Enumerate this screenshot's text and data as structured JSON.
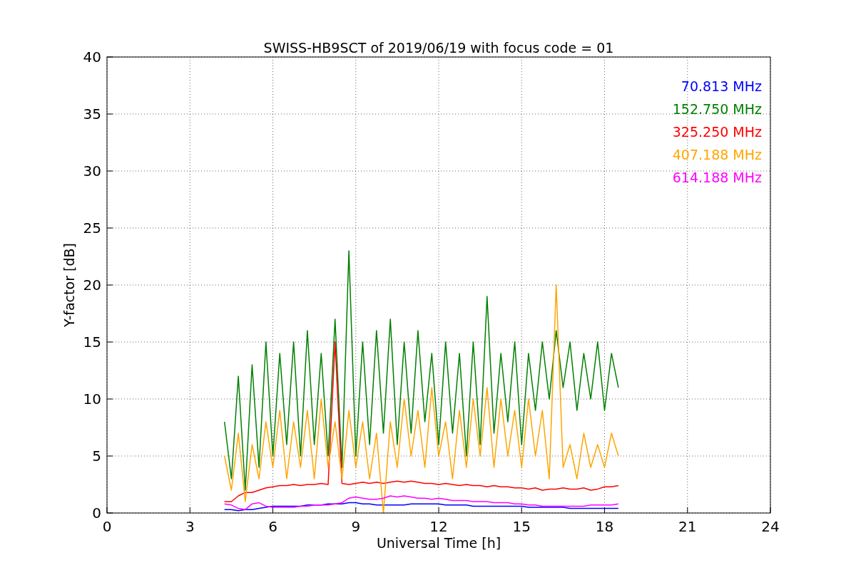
{
  "chart_data": {
    "type": "line",
    "title": "SWISS-HB9SCT of 2019/06/19 with focus code = 01",
    "xlabel": "Universal Time [h]",
    "ylabel": "Y-factor [dB]",
    "grid": true,
    "xlim": [
      0,
      24
    ],
    "ylim": [
      0,
      40
    ],
    "xticks": [
      0,
      3,
      6,
      9,
      12,
      15,
      18,
      21,
      24
    ],
    "yticks": [
      0,
      5,
      10,
      15,
      20,
      25,
      30,
      35,
      40
    ],
    "x": [
      4.25,
      4.5,
      4.75,
      5,
      5.25,
      5.5,
      5.75,
      6,
      6.25,
      6.5,
      6.75,
      7,
      7.25,
      7.5,
      7.75,
      8,
      8.25,
      8.5,
      8.75,
      9,
      9.25,
      9.5,
      9.75,
      10,
      10.25,
      10.5,
      10.75,
      11,
      11.25,
      11.5,
      11.75,
      12,
      12.25,
      12.5,
      12.75,
      13,
      13.25,
      13.5,
      13.75,
      14,
      14.25,
      14.5,
      14.75,
      15,
      15.25,
      15.5,
      15.75,
      16,
      16.25,
      16.5,
      16.75,
      17,
      17.25,
      17.5,
      17.75,
      18,
      18.25,
      18.5
    ],
    "series": [
      {
        "name": "70.813 MHz",
        "color": "#0000ff",
        "values": [
          0.3,
          0.3,
          0.2,
          0.3,
          0.3,
          0.4,
          0.5,
          0.6,
          0.6,
          0.6,
          0.6,
          0.6,
          0.7,
          0.7,
          0.7,
          0.8,
          0.8,
          0.8,
          0.9,
          0.9,
          0.8,
          0.8,
          0.7,
          0.7,
          0.7,
          0.7,
          0.7,
          0.8,
          0.8,
          0.8,
          0.8,
          0.8,
          0.7,
          0.7,
          0.7,
          0.7,
          0.6,
          0.6,
          0.6,
          0.6,
          0.6,
          0.6,
          0.6,
          0.6,
          0.5,
          0.5,
          0.5,
          0.5,
          0.5,
          0.5,
          0.4,
          0.4,
          0.4,
          0.4,
          0.4,
          0.4,
          0.4,
          0.4
        ]
      },
      {
        "name": "152.750 MHz",
        "color": "#008000",
        "values": [
          8,
          3,
          12,
          2,
          13,
          4,
          15,
          5,
          14,
          6,
          15,
          5,
          16,
          6,
          14,
          5,
          17,
          4,
          23,
          5,
          15,
          6,
          16,
          7,
          17,
          6,
          15,
          7,
          16,
          8,
          14,
          6,
          15,
          7,
          14,
          5,
          15,
          6,
          19,
          7,
          14,
          8,
          15,
          6,
          14,
          9,
          15,
          10,
          16,
          11,
          15,
          9,
          14,
          10,
          15,
          9,
          14,
          11
        ]
      },
      {
        "name": "325.250 MHz",
        "color": "#ff0000",
        "values": [
          1,
          1,
          1.5,
          1.8,
          1.8,
          2,
          2.2,
          2.3,
          2.4,
          2.4,
          2.5,
          2.4,
          2.5,
          2.5,
          2.6,
          2.5,
          15,
          2.6,
          2.5,
          2.6,
          2.7,
          2.6,
          2.7,
          2.6,
          2.7,
          2.8,
          2.7,
          2.8,
          2.7,
          2.6,
          2.6,
          2.5,
          2.6,
          2.5,
          2.4,
          2.5,
          2.4,
          2.4,
          2.3,
          2.4,
          2.3,
          2.3,
          2.2,
          2.2,
          2.1,
          2.2,
          2,
          2.1,
          2.1,
          2.2,
          2.1,
          2.1,
          2.2,
          2,
          2.1,
          2.3,
          2.3,
          2.4
        ]
      },
      {
        "name": "407.188 MHz",
        "color": "#ffa500",
        "values": [
          5,
          2,
          7,
          1,
          6,
          3,
          8,
          4,
          9,
          3,
          8,
          4,
          9,
          3,
          10,
          4,
          8,
          3,
          9,
          4,
          8,
          3,
          7,
          0,
          8,
          4,
          10,
          5,
          9,
          4,
          11,
          5,
          8,
          3,
          9,
          4,
          10,
          5,
          11,
          4,
          10,
          5,
          9,
          4,
          10,
          5,
          9,
          3,
          20,
          4,
          6,
          3,
          7,
          4,
          6,
          4,
          7,
          5
        ]
      },
      {
        "name": "614.188 MHz",
        "color": "#ff00ff",
        "values": [
          0.8,
          0.7,
          0.4,
          0.3,
          0.8,
          0.9,
          0.6,
          0.5,
          0.5,
          0.5,
          0.5,
          0.6,
          0.6,
          0.7,
          0.7,
          0.7,
          0.8,
          0.9,
          1.3,
          1.4,
          1.3,
          1.2,
          1.2,
          1.3,
          1.5,
          1.4,
          1.5,
          1.4,
          1.3,
          1.3,
          1.2,
          1.3,
          1.2,
          1.1,
          1.1,
          1.1,
          1.0,
          1.0,
          1.0,
          0.9,
          0.9,
          0.9,
          0.8,
          0.8,
          0.7,
          0.7,
          0.6,
          0.6,
          0.6,
          0.6,
          0.6,
          0.6,
          0.6,
          0.7,
          0.7,
          0.7,
          0.7,
          0.8
        ]
      }
    ]
  }
}
